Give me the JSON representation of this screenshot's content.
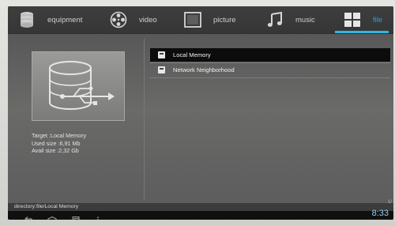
{
  "tabs": [
    {
      "label": "equipment",
      "icon": "database-icon",
      "active": false
    },
    {
      "label": "video",
      "icon": "film-reel-icon",
      "active": false
    },
    {
      "label": "picture",
      "icon": "picture-frame-icon",
      "active": false
    },
    {
      "label": "music",
      "icon": "music-note-icon",
      "active": false
    },
    {
      "label": "file",
      "icon": "grid-icon",
      "active": true
    }
  ],
  "storage_list": [
    {
      "label": "Local Memory",
      "selected": true
    },
    {
      "label": "Network Neighborhood",
      "selected": false
    }
  ],
  "details": {
    "target": "Target :Local Memory",
    "used": "Used size :6,91 Mb",
    "avail": "Avail size :2,32 Gb"
  },
  "path": "directory:file/Local Memory",
  "page_indicator": "1/",
  "clock": "8:33",
  "colors": {
    "accent": "#33b5e5",
    "selected_row": "#0c0c0c"
  }
}
